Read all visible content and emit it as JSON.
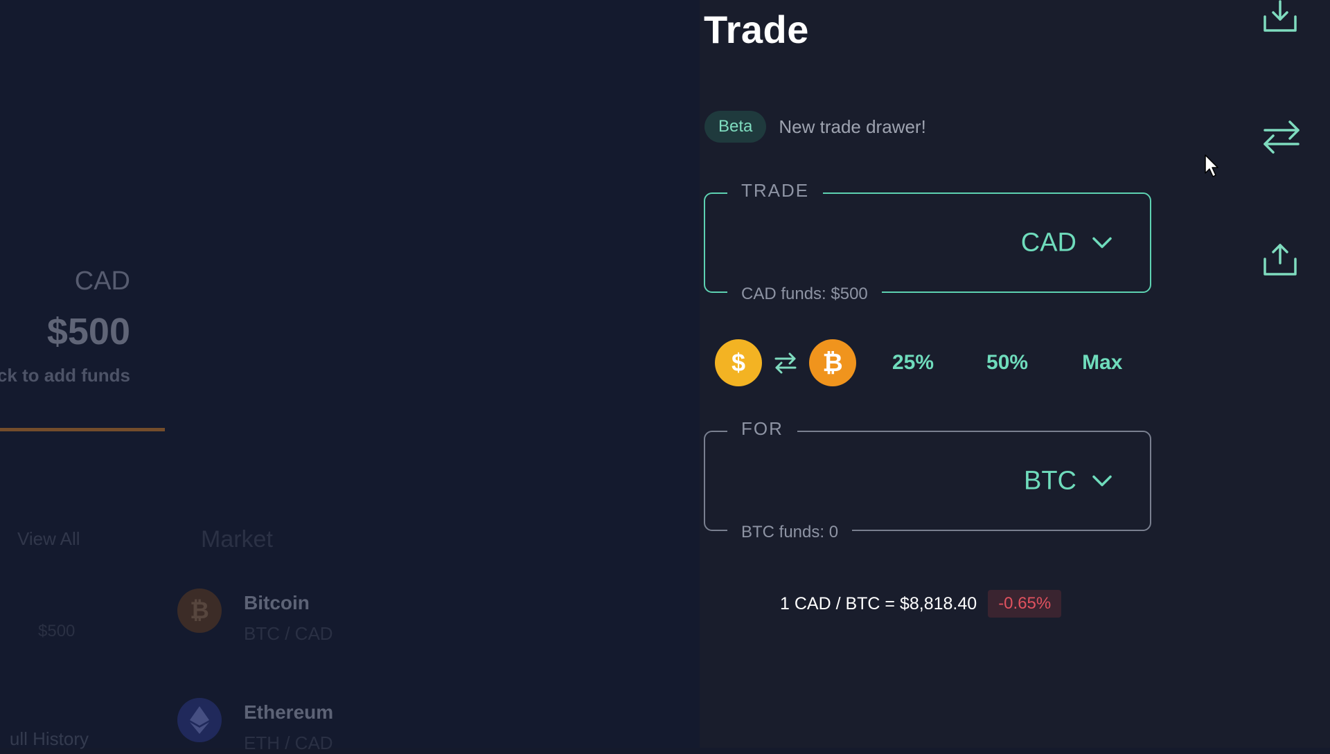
{
  "dashboard": {
    "balance_currency": "CAD",
    "balance_amount": "$500",
    "add_funds_hint": "ck to add funds",
    "view_all": "View All",
    "market_title": "Market",
    "small_balance": "$500",
    "full_history": "ull History",
    "coins": [
      {
        "name": "Bitcoin",
        "pair": "BTC / CAD",
        "icon": "bitcoin-icon"
      },
      {
        "name": "Ethereum",
        "pair": "ETH / CAD",
        "icon": "ethereum-icon"
      }
    ]
  },
  "drawer": {
    "title": "Trade",
    "beta_badge": "Beta",
    "beta_text": "New trade drawer!",
    "trade_field": {
      "legend": "TRADE",
      "currency": "CAD",
      "funds": "CAD funds: $500"
    },
    "for_field": {
      "legend": "FOR",
      "currency": "BTC",
      "funds": "BTC funds: 0"
    },
    "coin_from_symbol": "$",
    "coin_to_symbol": "₿",
    "percent_options": [
      "25%",
      "50%",
      "Max"
    ],
    "rate": "1 CAD / BTC = $8,818.40",
    "change": "-0.65%"
  },
  "side_icons": [
    "download-icon",
    "swap-icon",
    "upload-icon"
  ],
  "colors": {
    "accent": "#6fdcbc",
    "negative": "#e0525f",
    "bitcoin": "#f0941d",
    "dollar": "#f3b323",
    "background": "#191d2c"
  }
}
